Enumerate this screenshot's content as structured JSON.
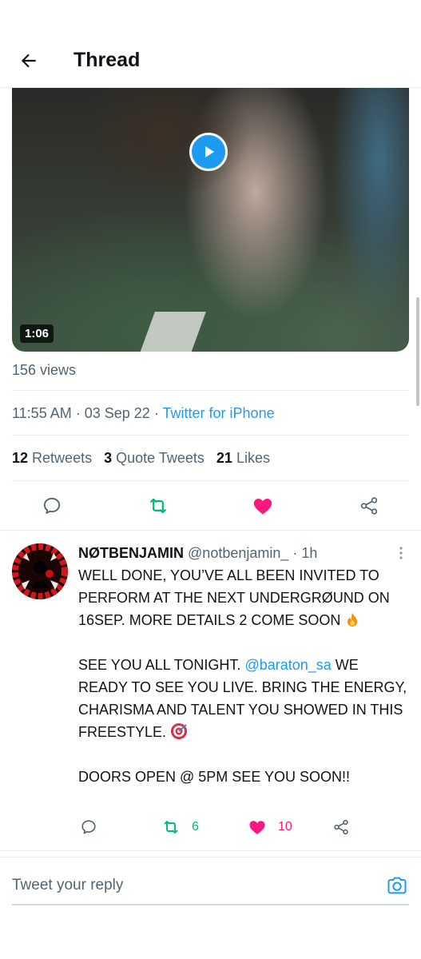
{
  "header": {
    "title": "Thread",
    "back_icon": "arrow-left-icon"
  },
  "video": {
    "duration": "1:06",
    "play_icon": "play-icon"
  },
  "tweet": {
    "views": "156 views",
    "time": "11:55 AM",
    "date": "03 Sep 22",
    "separator": "·",
    "source": "Twitter for iPhone",
    "stats": {
      "retweets_count": "12",
      "retweets_label": "Retweets",
      "quotes_count": "3",
      "quotes_label": "Quote Tweets",
      "likes_count": "21",
      "likes_label": "Likes"
    },
    "actions": [
      "reply-icon",
      "retweet-icon",
      "like-icon",
      "share-icon"
    ]
  },
  "reply": {
    "name": "NØTBENJAMIN",
    "handle": "@notbenjamin_",
    "separator": "·",
    "time": "1h",
    "p1": "WELL DONE, YOU’VE ALL BEEN INVITED TO PERFORM AT THE NEXT UNDERGRØUND ON 16SEP. MORE DETAILS 2 COME SOON",
    "p2a": "SEE YOU ALL TONIGHT.",
    "mention": "@baraton_sa",
    "p2b": "WE READY TO SEE YOU LIVE. BRING THE ENERGY, CHARISMA AND TALENT YOU SHOWED IN THIS FREESTYLE.",
    "p3": "DOORS OPEN @ 5PM SEE YOU SOON!!",
    "retweet_count": "6",
    "like_count": "10"
  },
  "compose": {
    "placeholder": "Tweet your reply",
    "camera_icon": "camera-icon"
  },
  "colors": {
    "accent": "#1d9bf0",
    "retweet": "#00ba7c",
    "like": "#f91880",
    "text": "#0f1419",
    "muted": "#536471"
  }
}
